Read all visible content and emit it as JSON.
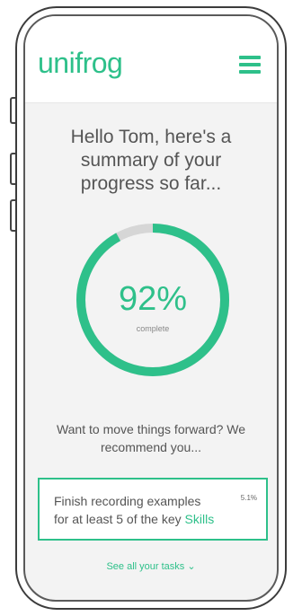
{
  "app": {
    "logo": "unifrog",
    "brand_color": "#2ec08a"
  },
  "header": {
    "menu_icon": "hamburger-menu-icon"
  },
  "summary": {
    "greeting_line1": "Hello Tom, here's a",
    "greeting_line2": "summary of your",
    "greeting_line3": "progress so far...",
    "progress_value": 0.92,
    "percent_label": "92%",
    "complete_label": "complete"
  },
  "recommendation": {
    "line1": "Want to move things forward? We",
    "line2": "recommend you..."
  },
  "task": {
    "text_line1": "Finish recording examples",
    "text_line2": "for at least 5 of the key",
    "link_text": "Skills",
    "percent": "5.1%"
  },
  "footer": {
    "see_all_label": "See all your tasks ⌄"
  }
}
